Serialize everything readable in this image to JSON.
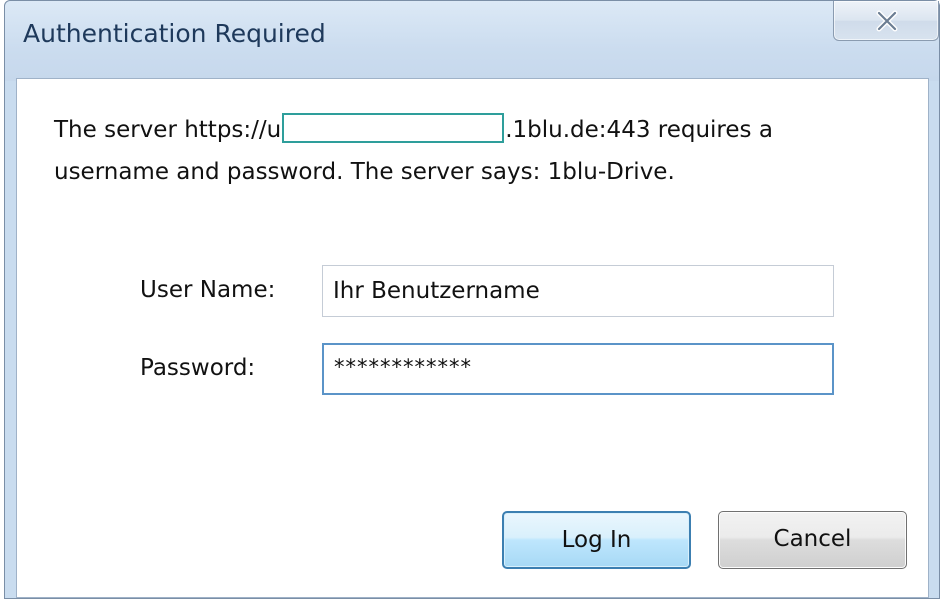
{
  "dialog": {
    "title": "Authentication Required",
    "message": {
      "line1_prefix": "The server https://u",
      "line1_suffix": ".1blu.de:443 requires a",
      "line2": "username and password. The server says: 1blu-Drive."
    },
    "username": {
      "label": "User Name:",
      "value": "Ihr Benutzername"
    },
    "password": {
      "label": "Password:",
      "value": "************"
    },
    "buttons": {
      "login_label": "Log In",
      "cancel_label": "Cancel"
    },
    "icons": {
      "close": "close-icon"
    },
    "colors": {
      "frame": "#c9dcef",
      "title_text": "#1e395b",
      "focus_border": "#5b94c8",
      "default_button_border": "#3c7fb1",
      "redaction_border": "#2e9e9b"
    }
  }
}
